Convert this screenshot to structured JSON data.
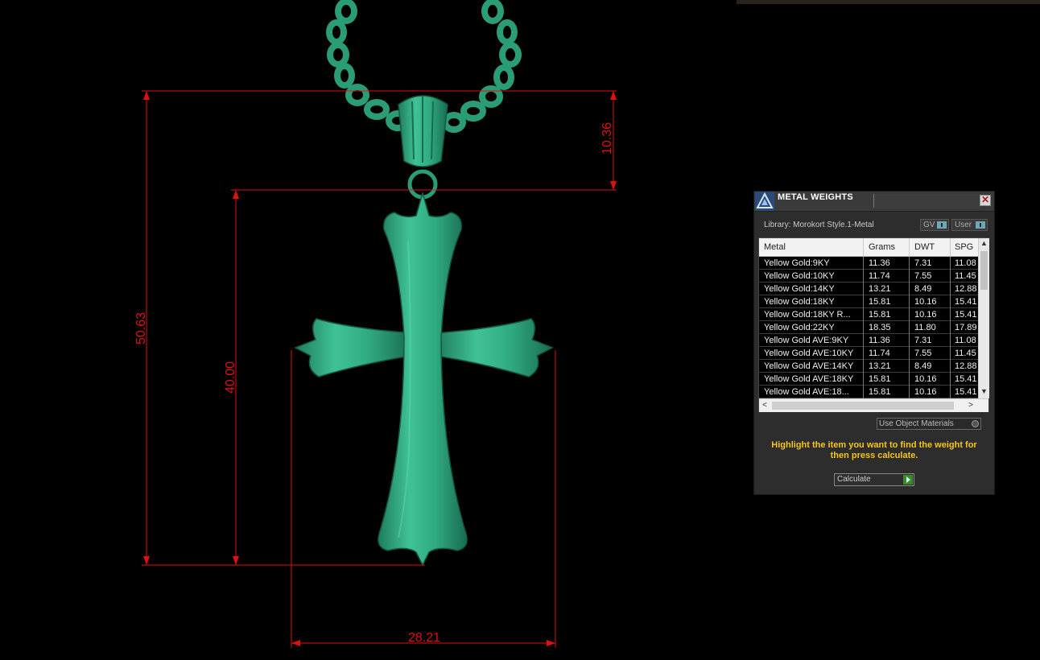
{
  "viewport": {
    "dimensions": [
      {
        "name": "total-height",
        "value": "50.63"
      },
      {
        "name": "cross-height",
        "value": "40.00"
      },
      {
        "name": "bail-height",
        "value": "10.36"
      },
      {
        "name": "cross-width",
        "value": "28.21"
      }
    ],
    "colors": {
      "model": "#2eaa82",
      "dimension": "#e01010"
    }
  },
  "panel": {
    "title": "METAL WEIGHTS",
    "close_label": "✕",
    "library": "Library: Morokort Style.1-Metal",
    "toggle_gv": "GV",
    "toggle_user": "User",
    "table": {
      "headers": [
        "Metal",
        "Grams",
        "DWT",
        "SPG"
      ],
      "rows": [
        [
          "Yellow Gold:9KY",
          "11.36",
          "7.31",
          "11.08"
        ],
        [
          "Yellow Gold:10KY",
          "11.74",
          "7.55",
          "11.45"
        ],
        [
          "Yellow Gold:14KY",
          "13.21",
          "8.49",
          "12.88"
        ],
        [
          "Yellow Gold:18KY",
          "15.81",
          "10.16",
          "15.41"
        ],
        [
          "Yellow Gold:18KY R...",
          "15.81",
          "10.16",
          "15.41"
        ],
        [
          "Yellow Gold:22KY",
          "18.35",
          "11.80",
          "17.89"
        ],
        [
          "Yellow Gold AVE:9KY",
          "11.36",
          "7.31",
          "11.08"
        ],
        [
          "Yellow Gold AVE:10KY",
          "11.74",
          "7.55",
          "11.45"
        ],
        [
          "Yellow Gold AVE:14KY",
          "13.21",
          "8.49",
          "12.88"
        ],
        [
          "Yellow Gold AVE:18KY",
          "15.81",
          "10.16",
          "15.41"
        ],
        [
          "Yellow Gold AVE:18...",
          "15.81",
          "10.16",
          "15.41"
        ]
      ]
    },
    "use_object_materials": "Use Object Materials",
    "instruction": "Highlight the item you want to find the weight for then press calculate.",
    "calculate_label": "Calculate"
  }
}
